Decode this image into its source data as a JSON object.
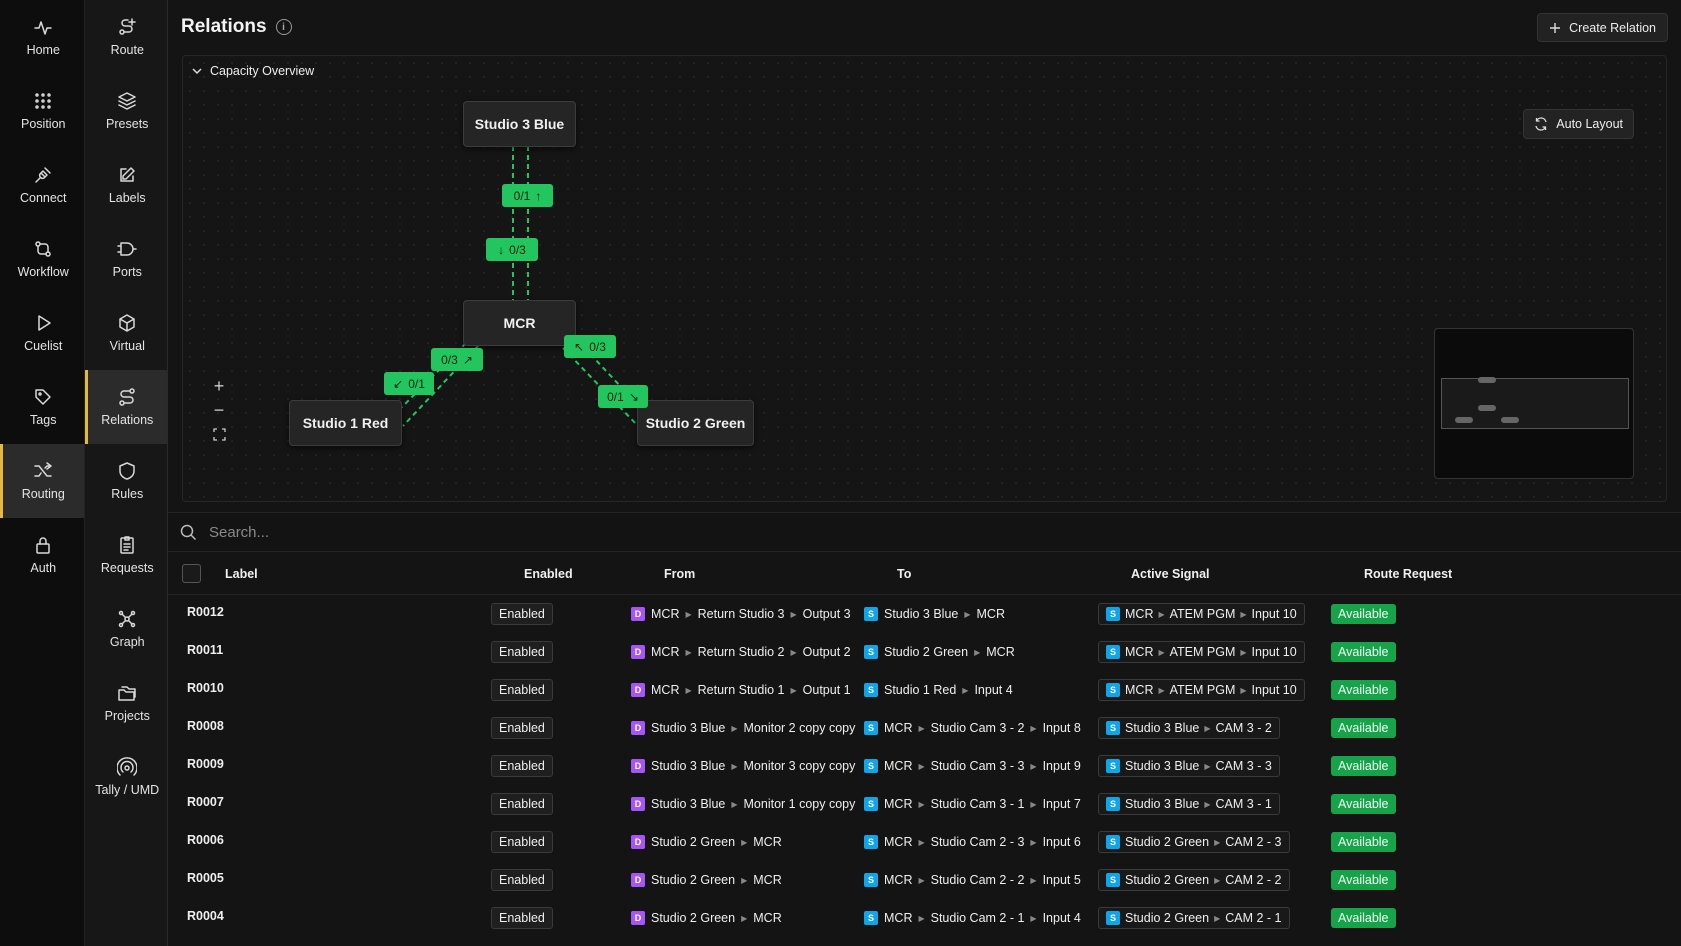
{
  "sidebar": {
    "col1": [
      {
        "label": "Home",
        "icon": "pulse-icon"
      },
      {
        "label": "Position",
        "icon": "grid-dots-icon"
      },
      {
        "label": "Connect",
        "icon": "plug-icon"
      },
      {
        "label": "Workflow",
        "icon": "workflow-icon"
      },
      {
        "label": "Cuelist",
        "icon": "play-icon"
      },
      {
        "label": "Tags",
        "icon": "tag-icon"
      },
      {
        "label": "Routing",
        "icon": "shuffle-icon",
        "active": true
      },
      {
        "label": "Auth",
        "icon": "lock-icon"
      }
    ],
    "col2": [
      {
        "label": "Route",
        "icon": "route-plus-icon"
      },
      {
        "label": "Presets",
        "icon": "layers-icon"
      },
      {
        "label": "Labels",
        "icon": "pencil-square-icon"
      },
      {
        "label": "Ports",
        "icon": "port-icon"
      },
      {
        "label": "Virtual",
        "icon": "cube-icon"
      },
      {
        "label": "Relations",
        "icon": "relations-icon",
        "active": true
      },
      {
        "label": "Rules",
        "icon": "shield-icon"
      },
      {
        "label": "Requests",
        "icon": "clipboard-icon"
      },
      {
        "label": "Graph",
        "icon": "graph-icon"
      },
      {
        "label": "Projects",
        "icon": "folders-icon"
      },
      {
        "label": "Tally / UMD",
        "icon": "broadcast-icon"
      }
    ]
  },
  "header": {
    "title": "Relations",
    "create_label": "Create Relation"
  },
  "canvas": {
    "section_label": "Capacity Overview",
    "auto_layout_label": "Auto Layout",
    "nodes": {
      "studio3": "Studio 3 Blue",
      "mcr": "MCR",
      "studio1": "Studio 1 Red",
      "studio2": "Studio 2 Green"
    },
    "edges": {
      "s3_up": "0/1",
      "s3_down": "0/3",
      "s1_up": "0/3",
      "s1_down": "0/1",
      "s2_up": "0/3",
      "s2_down": "0/1"
    },
    "zoom": {
      "in": "+",
      "out": "−"
    }
  },
  "search": {
    "placeholder": "Search..."
  },
  "table": {
    "headers": {
      "label": "Label",
      "enabled": "Enabled",
      "from": "From",
      "to": "To",
      "active": "Active Signal",
      "request": "Route Request"
    },
    "rows": [
      {
        "label": "R0012",
        "enabled": "Enabled",
        "from": [
          "MCR",
          "Return Studio 3",
          "Output 3"
        ],
        "to": [
          "Studio 3 Blue",
          "MCR"
        ],
        "active": [
          "MCR",
          "ATEM PGM",
          "Input 10"
        ],
        "request": "Available"
      },
      {
        "label": "R0011",
        "enabled": "Enabled",
        "from": [
          "MCR",
          "Return Studio 2",
          "Output 2"
        ],
        "to": [
          "Studio 2 Green",
          "MCR"
        ],
        "active": [
          "MCR",
          "ATEM PGM",
          "Input 10"
        ],
        "request": "Available"
      },
      {
        "label": "R0010",
        "enabled": "Enabled",
        "from": [
          "MCR",
          "Return Studio 1",
          "Output 1"
        ],
        "to": [
          "Studio 1 Red",
          "Input 4"
        ],
        "active": [
          "MCR",
          "ATEM PGM",
          "Input 10"
        ],
        "request": "Available"
      },
      {
        "label": "R0008",
        "enabled": "Enabled",
        "from": [
          "Studio 3 Blue",
          "Monitor 2 copy copy"
        ],
        "to": [
          "MCR",
          "Studio Cam 3 - 2",
          "Input 8"
        ],
        "active": [
          "Studio 3 Blue",
          "CAM 3 - 2"
        ],
        "request": "Available"
      },
      {
        "label": "R0009",
        "enabled": "Enabled",
        "from": [
          "Studio 3 Blue",
          "Monitor 3 copy copy"
        ],
        "to": [
          "MCR",
          "Studio Cam 3 - 3",
          "Input 9"
        ],
        "active": [
          "Studio 3 Blue",
          "CAM 3 - 3"
        ],
        "request": "Available"
      },
      {
        "label": "R0007",
        "enabled": "Enabled",
        "from": [
          "Studio 3 Blue",
          "Monitor 1 copy copy"
        ],
        "to": [
          "MCR",
          "Studio Cam 3 - 1",
          "Input 7"
        ],
        "active": [
          "Studio 3 Blue",
          "CAM 3 - 1"
        ],
        "request": "Available"
      },
      {
        "label": "R0006",
        "enabled": "Enabled",
        "from": [
          "Studio 2 Green",
          "MCR"
        ],
        "to": [
          "MCR",
          "Studio Cam 2 - 3",
          "Input 6"
        ],
        "active": [
          "Studio 2 Green",
          "CAM 2 - 3"
        ],
        "request": "Available"
      },
      {
        "label": "R0005",
        "enabled": "Enabled",
        "from": [
          "Studio 2 Green",
          "MCR"
        ],
        "to": [
          "MCR",
          "Studio Cam 2 - 2",
          "Input 5"
        ],
        "active": [
          "Studio 2 Green",
          "CAM 2 - 2"
        ],
        "request": "Available"
      },
      {
        "label": "R0004",
        "enabled": "Enabled",
        "from": [
          "Studio 2 Green",
          "MCR"
        ],
        "to": [
          "MCR",
          "Studio Cam 2 - 1",
          "Input 4"
        ],
        "active": [
          "Studio 2 Green",
          "CAM 2 - 1"
        ],
        "request": "Available"
      }
    ]
  },
  "colors": {
    "accent_active": "#e5b843",
    "edge_green": "#22c55e",
    "device_badge": "#a855f7",
    "source_badge": "#0ea5e9",
    "available": "#16a34a"
  }
}
